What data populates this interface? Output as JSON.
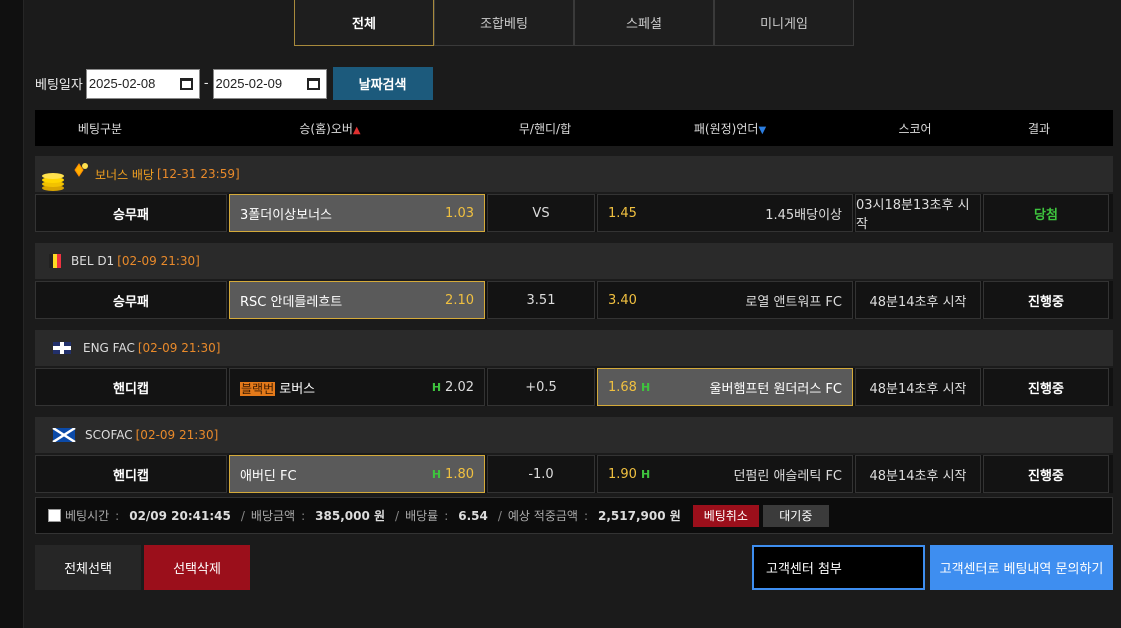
{
  "tabs": [
    {
      "label": "전체"
    },
    {
      "label": "조합베팅"
    },
    {
      "label": "스페셜"
    },
    {
      "label": "미니게임"
    }
  ],
  "date_filter": {
    "label": "베팅일자",
    "from": "2025-02-08",
    "separator": "-",
    "to": "2025-02-09",
    "search_label": "날짜검색"
  },
  "table_header": {
    "type": "베팅구분",
    "home": "승(홈)오버",
    "draw": "무/핸디/합",
    "away": "패(원정)언더",
    "score": "스코어",
    "result": "결과"
  },
  "groups": [
    {
      "league": "보너스 배당",
      "time": "[12-31 23:59]",
      "type": "승무패",
      "home": "3폴더이상보너스",
      "home_odd": "1.03",
      "mid": "VS",
      "away_odd": "1.45",
      "away": "1.45배당이상",
      "score": "03시18분13초후 시작",
      "result": "당첨"
    },
    {
      "league": "BEL D1",
      "time": "[02-09 21:30]",
      "type": "승무패",
      "home": "RSC 안데를레흐트",
      "home_odd": "2.10",
      "mid": "3.51",
      "away_odd": "3.40",
      "away": "로열 앤트워프 FC",
      "score": "48분14초후 시작",
      "result": "진행중"
    },
    {
      "league": "ENG FAC",
      "time": "[02-09 21:30]",
      "type": "핸디캡",
      "home": "로버스",
      "home_prefix": "블랙번",
      "home_odd": "2.02",
      "mid": "+0.5",
      "away_odd": "1.68",
      "away": "울버햄프턴 원더러스 FC",
      "score": "48분14초후 시작",
      "result": "진행중"
    },
    {
      "league": "SCOFAC",
      "time": "[02-09 21:30]",
      "type": "핸디캡",
      "home": "애버딘 FC",
      "home_odd": "1.80",
      "mid": "-1.0",
      "away_odd": "1.90",
      "away": "던펌린 애슬레틱 FC",
      "score": "48분14초후 시작",
      "result": "진행중"
    }
  ],
  "handicap_mark": "H",
  "summary": {
    "time_label": "베팅시간",
    "time": "02/09 20:41:45",
    "amount_label": "배당금액",
    "amount": "385,000 원",
    "rate_label": "배당률",
    "rate": "6.54",
    "expected_label": "예상 적중금액",
    "expected": "2,517,900 원",
    "cancel_label": "베팅취소",
    "status_label": "대기중"
  },
  "actions": {
    "select_all": "전체선택",
    "delete_selected": "선택삭제",
    "attach": "고객센터 첨부",
    "inquire": "고객센터로 베팅내역 문의하기"
  },
  "colors": {
    "accent_gold": "#d4aa3a",
    "odd_yellow": "#f0c040",
    "win_green": "#3ec43e",
    "danger_red": "#9b0f1b",
    "primary_blue": "#3e8ef0",
    "search_blue": "#1c5a7c"
  }
}
